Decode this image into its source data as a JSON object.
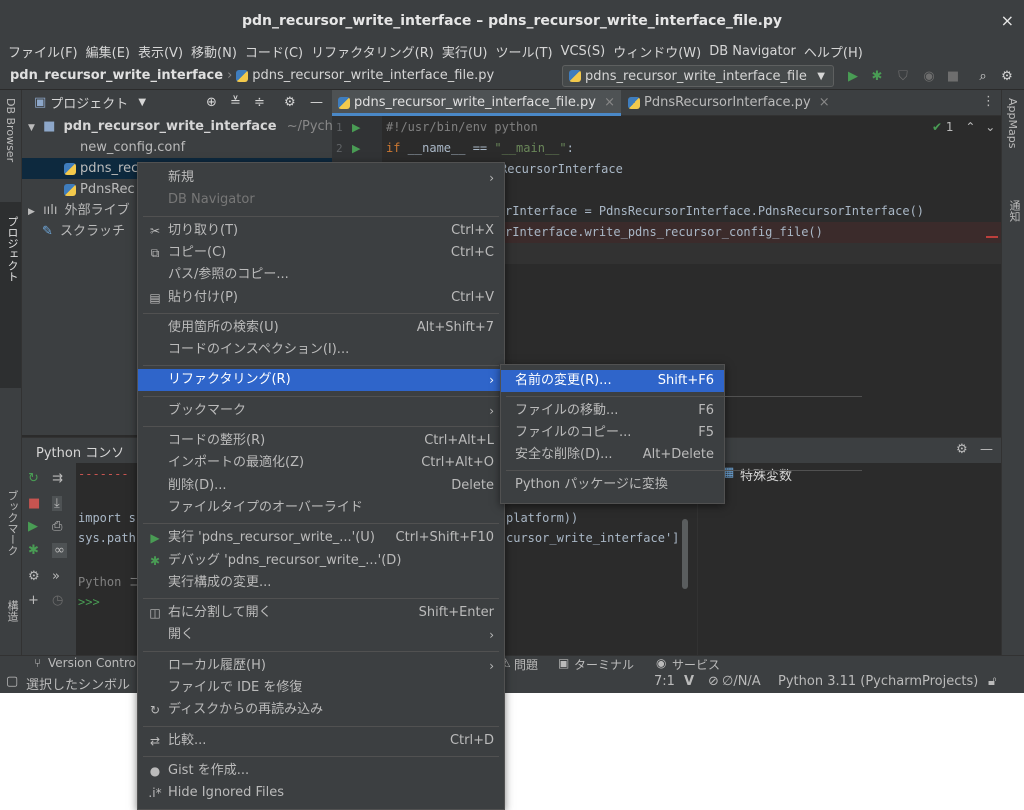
{
  "window": {
    "title": "pdn_recursor_write_interface – pdns_recursor_write_interface_file.py",
    "close": "×"
  },
  "menubar": [
    "ファイル(F)",
    "編集(E)",
    "表示(V)",
    "移動(N)",
    "コード(C)",
    "リファクタリング(R)",
    "実行(U)",
    "ツール(T)",
    "VCS(S)",
    "ウィンドウ(W)",
    "DB Navigator",
    "ヘルプ(H)"
  ],
  "navbar": {
    "project": "pdn_recursor_write_interface",
    "file": "pdns_recursor_write_interface_file.py",
    "run_config": "pdns_recursor_write_interface_file"
  },
  "left_strip": {
    "db_browser": "DB Browser",
    "project": "プロジェクト",
    "bookmarks": "ブックマーク",
    "structure": "構造"
  },
  "right_strip": {
    "appmaps": "AppMaps",
    "notifications": "通知"
  },
  "project_panel": {
    "title": "プロジェクト",
    "tree": [
      {
        "label": "pdn_recursor_write_interface",
        "suffix": "~/Pychar"
      },
      {
        "label": "new_config.conf"
      },
      {
        "label": "pdns_rec"
      },
      {
        "label": "PdnsRec"
      },
      {
        "label": "外部ライブ"
      },
      {
        "label": "スクラッチ"
      }
    ]
  },
  "editor": {
    "tabs": [
      "pdns_recursor_write_interface_file.py",
      "PdnsRecursorInterface.py"
    ],
    "inspection": "1",
    "line_numbers": [
      "1",
      "2"
    ],
    "code": [
      "#!/usr/bin/env python",
      "if __name__ == \"__main__\":",
      "RecursorInterface",
      "",
      "rInterface = PdnsRecursorInterface.PdnsRecursorInterface()",
      "rInterface.write_pdns_recursor_config_file()"
    ]
  },
  "console": {
    "title": "Python コンソ",
    "lines": [
      "-------",
      "",
      "import s",
      "sys.path",
      "",
      "Python コ",
      ">>>"
    ],
    "right_lines": [
      "platform))",
      "cursor_write_interface']"
    ],
    "variables": "特殊変数"
  },
  "bottom_tabs": {
    "vcs": "Version Control",
    "problems": "問題",
    "terminal": "ターミナル",
    "services": "サービス"
  },
  "status": {
    "left": "選択したシンボル",
    "position": "7:1",
    "na": "∅/N/A",
    "interpreter": "Python 3.11 (PycharmProjects)"
  },
  "context_menu": [
    {
      "label": "新規",
      "submenu": true
    },
    {
      "label": "DB Navigator",
      "disabled": true
    },
    {
      "sep": true
    },
    {
      "label": "切り取り(T)",
      "shortcut": "Ctrl+X",
      "icon": "✂"
    },
    {
      "label": "コピー(C)",
      "shortcut": "Ctrl+C",
      "icon": "⧉"
    },
    {
      "label": "パス/参照のコピー..."
    },
    {
      "label": "貼り付け(P)",
      "shortcut": "Ctrl+V",
      "icon": "📋"
    },
    {
      "sep": true
    },
    {
      "label": "使用箇所の検索(U)",
      "shortcut": "Alt+Shift+7"
    },
    {
      "label": "コードのインスペクション(I)..."
    },
    {
      "sep": true
    },
    {
      "label": "リファクタリング(R)",
      "submenu": true,
      "selected": true
    },
    {
      "sep": true
    },
    {
      "label": "ブックマーク",
      "submenu": true
    },
    {
      "sep": true
    },
    {
      "label": "コードの整形(R)",
      "shortcut": "Ctrl+Alt+L"
    },
    {
      "label": "インポートの最適化(Z)",
      "shortcut": "Ctrl+Alt+O"
    },
    {
      "label": "削除(D)...",
      "shortcut": "Delete"
    },
    {
      "label": "ファイルタイプのオーバーライド"
    },
    {
      "sep": true
    },
    {
      "label": "実行 'pdns_recursor_write_...'(U)",
      "shortcut": "Ctrl+Shift+F10",
      "icon": "▶"
    },
    {
      "label": "デバッグ 'pdns_recursor_write_...'(D)",
      "icon": "🐞"
    },
    {
      "label": "実行構成の変更..."
    },
    {
      "sep": true
    },
    {
      "label": "右に分割して開く",
      "shortcut": "Shift+Enter",
      "icon": "◫"
    },
    {
      "label": "開く",
      "submenu": true
    },
    {
      "sep": true
    },
    {
      "label": "ローカル履歴(H)",
      "submenu": true
    },
    {
      "label": "ファイルで IDE を修復"
    },
    {
      "label": "ディスクからの再読み込み",
      "icon": "↻"
    },
    {
      "sep": true
    },
    {
      "label": "比較...",
      "shortcut": "Ctrl+D",
      "icon": "⇄"
    },
    {
      "sep": true
    },
    {
      "label": "Gist を作成...",
      "icon": "●"
    },
    {
      "label": "Hide Ignored Files",
      "icon": ".i*"
    }
  ],
  "submenu": [
    {
      "label": "名前の変更(R)...",
      "shortcut": "Shift+F6",
      "selected": true
    },
    {
      "sep": true
    },
    {
      "label": "ファイルの移動...",
      "shortcut": "F6"
    },
    {
      "label": "ファイルのコピー...",
      "shortcut": "F5"
    },
    {
      "label": "安全な削除(D)...",
      "shortcut": "Alt+Delete"
    },
    {
      "sep": true
    },
    {
      "label": "Python パッケージに変換"
    }
  ],
  "colors": {
    "selection": "#2f65ca",
    "panel": "#3c3f41",
    "editor_bg": "#2b2b2b",
    "keyword": "#cc7832",
    "string": "#6a8759",
    "comment": "#808080",
    "run_green": "#499c54"
  }
}
